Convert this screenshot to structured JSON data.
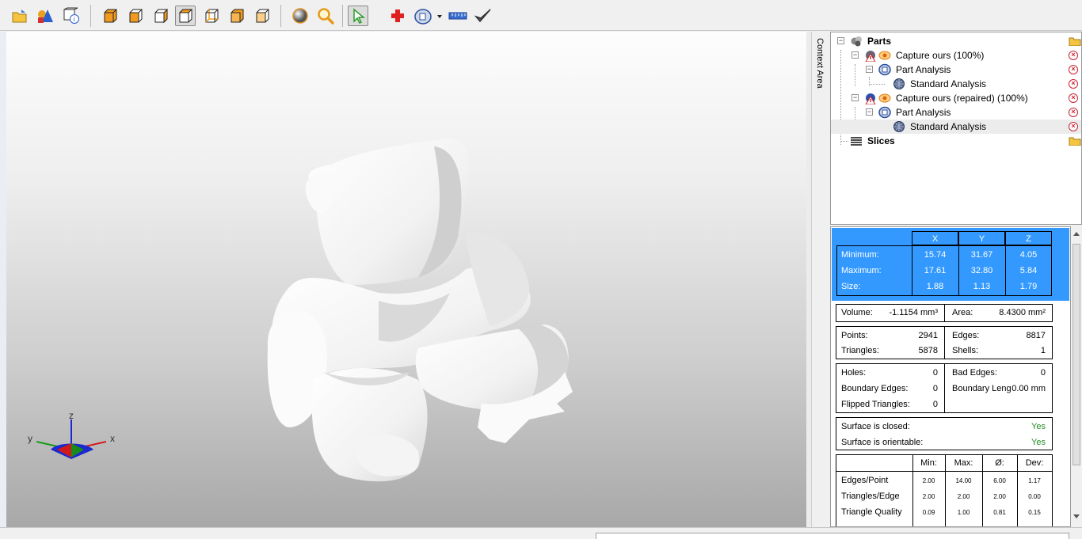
{
  "toolbar": {
    "buttons": [
      {
        "icon": "open-folder-icon"
      },
      {
        "icon": "primitives-icon"
      },
      {
        "icon": "part-info-icon"
      },
      {
        "icon": "view-iso-cube-icon"
      },
      {
        "icon": "view-front-cube-icon"
      },
      {
        "icon": "view-right-cube-icon"
      },
      {
        "icon": "view-top-cube-icon"
      },
      {
        "icon": "view-back-cube-icon"
      },
      {
        "icon": "view-left-cube-icon"
      },
      {
        "icon": "view-bottom-cube-icon"
      },
      {
        "icon": "shaded-sphere-icon"
      },
      {
        "icon": "zoom-icon"
      },
      {
        "icon": "select-arrow-icon"
      },
      {
        "icon": "add-red-cross-icon"
      },
      {
        "icon": "analysis-dropdown-icon"
      },
      {
        "icon": "measure-ruler-icon"
      },
      {
        "icon": "apply-check-icon"
      }
    ]
  },
  "context_area_label": "Context Area",
  "axes_widget": {
    "z": "z",
    "y": "y",
    "x": "x"
  },
  "tree": {
    "parts_label": "Parts",
    "slices_label": "Slices",
    "items": [
      {
        "label": "Capture ours (100%)"
      },
      {
        "label": "Part Analysis"
      },
      {
        "label": "Standard Analysis"
      },
      {
        "label": "Capture ours (repaired) (100%)"
      },
      {
        "label": "Part Analysis"
      },
      {
        "label": "Standard Analysis"
      }
    ]
  },
  "bounding_box": {
    "headers": [
      "X",
      "Y",
      "Z"
    ],
    "rows": [
      {
        "label": "Minimum:",
        "x": "15.74",
        "y": "31.67",
        "z": "4.05"
      },
      {
        "label": "Maximum:",
        "x": "17.61",
        "y": "32.80",
        "z": "5.84"
      },
      {
        "label": "Size:",
        "x": "1.88",
        "y": "1.13",
        "z": "1.79"
      }
    ]
  },
  "volume_area": {
    "volume_label": "Volume:",
    "volume_value": "-1.1154 mm³",
    "area_label": "Area:",
    "area_value": "8.4300 mm²"
  },
  "counts": {
    "points_label": "Points:",
    "points_value": "2941",
    "edges_label": "Edges:",
    "edges_value": "8817",
    "triangles_label": "Triangles:",
    "triangles_value": "5878",
    "shells_label": "Shells:",
    "shells_value": "1"
  },
  "defects": {
    "holes_label": "Holes:",
    "holes_value": "0",
    "bad_edges_label": "Bad Edges:",
    "bad_edges_value": "0",
    "boundary_edges_label": "Boundary Edges:",
    "boundary_edges_value": "0",
    "boundary_length_label": "Boundary Leng",
    "boundary_length_value": "0.00 mm",
    "flipped_label": "Flipped Triangles:",
    "flipped_value": "0"
  },
  "surface": {
    "closed_label": "Surface is closed:",
    "closed_value": "Yes",
    "orientable_label": "Surface is orientable:",
    "orientable_value": "Yes"
  },
  "stats": {
    "headers": [
      "Min:",
      "Max:",
      "Ø:",
      "Dev:"
    ],
    "rows": [
      {
        "label": "Edges/Point",
        "min": "2.00",
        "max": "14.00",
        "avg": "6.00",
        "dev": "1.17"
      },
      {
        "label": "Triangles/Edge",
        "min": "2.00",
        "max": "2.00",
        "avg": "2.00",
        "dev": "0.00"
      },
      {
        "label": "Triangle Quality",
        "min": "0.09",
        "max": "1.00",
        "avg": "0.81",
        "dev": "0.15"
      }
    ]
  },
  "colors": {
    "selection_blue": "#3399ff",
    "yes_green": "#2a8a2a"
  }
}
